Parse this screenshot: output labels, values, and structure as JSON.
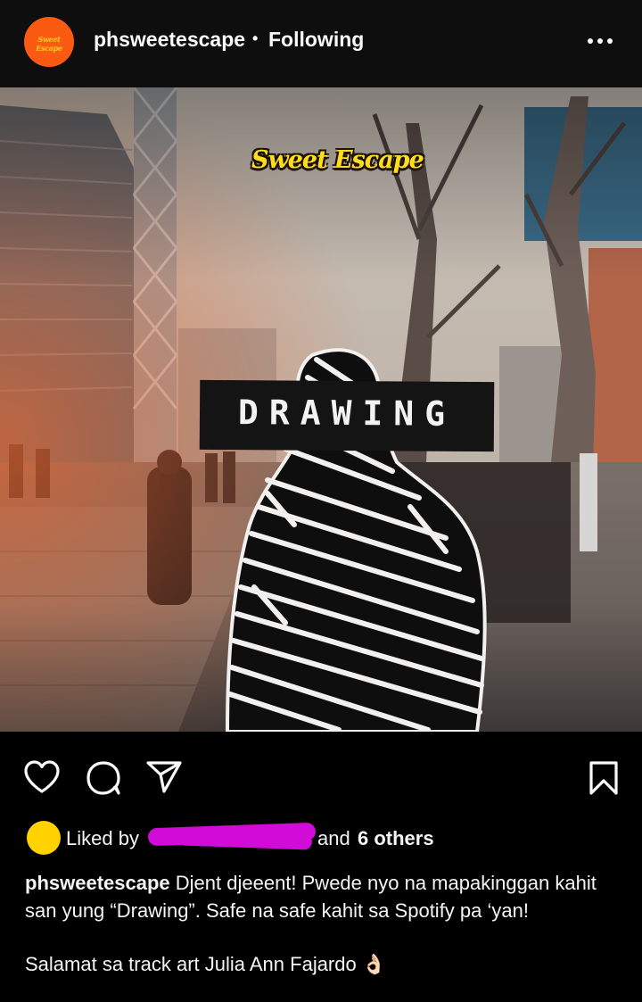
{
  "header": {
    "username": "phsweetescape",
    "separator": "•",
    "follow_status": "Following",
    "avatar_text": "Sweet Escape"
  },
  "post": {
    "image_logo_text": "Sweet Escape",
    "image_title_text": "DRAWING"
  },
  "likes": {
    "prefix": "Liked by",
    "conjunction": "and",
    "others": "6 others"
  },
  "caption": {
    "username": "phsweetescape",
    "text": "Djent djeeent! Pwede nyo na mapakinggan kahit san yung “Drawing”. Safe na safe kahit sa Spotify pa ‘yan!",
    "line2": "Salamat sa track art Julia Ann Fajardo 👌🏻"
  },
  "colors": {
    "avatar_bg": "#fb5a13",
    "liker_avatar": "#ffd200",
    "redaction": "#d30bd8"
  }
}
